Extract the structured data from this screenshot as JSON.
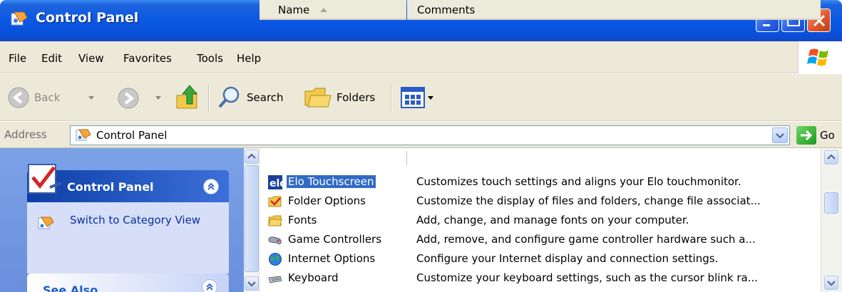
{
  "window": {
    "title": "Control Panel"
  },
  "menu": {
    "items": [
      {
        "label": "File"
      },
      {
        "label": "Edit"
      },
      {
        "label": "View"
      },
      {
        "label": "Favorites"
      },
      {
        "label": "Tools"
      },
      {
        "label": "Help"
      }
    ]
  },
  "toolbar": {
    "back_label": "Back",
    "search_label": "Search",
    "folders_label": "Folders"
  },
  "address": {
    "label": "Address",
    "value": "Control Panel",
    "go_label": "Go"
  },
  "taskpane": {
    "panel_title": "Control Panel",
    "switch_link": "Switch to Category View",
    "see_also_title": "See Also"
  },
  "list": {
    "columns": [
      {
        "label": "Name"
      },
      {
        "label": "Comments"
      }
    ],
    "rows": [
      {
        "name": "Elo Touchscreen",
        "comment": "Customizes touch settings and aligns your Elo touchmonitor.",
        "icon": "elo-icon",
        "selected": true
      },
      {
        "name": "Folder Options",
        "comment": "Customize the display of files and folders, change file associat...",
        "icon": "folder-options-icon"
      },
      {
        "name": "Fonts",
        "comment": "Add, change, and manage fonts on your computer.",
        "icon": "fonts-folder-icon"
      },
      {
        "name": "Game Controllers",
        "comment": "Add, remove, and configure game controller hardware such a...",
        "icon": "gamepad-icon"
      },
      {
        "name": "Internet Options",
        "comment": "Configure your Internet display and connection settings.",
        "icon": "globe-icon"
      },
      {
        "name": "Keyboard",
        "comment": "Customize your keyboard settings, such as the cursor blink ra...",
        "icon": "keyboard-icon"
      }
    ]
  },
  "colors": {
    "titlebar": "#0a58e3",
    "taskpane_bg": "#6a8fdc",
    "selection": "#316ac5",
    "link": "#0a2ca5"
  }
}
